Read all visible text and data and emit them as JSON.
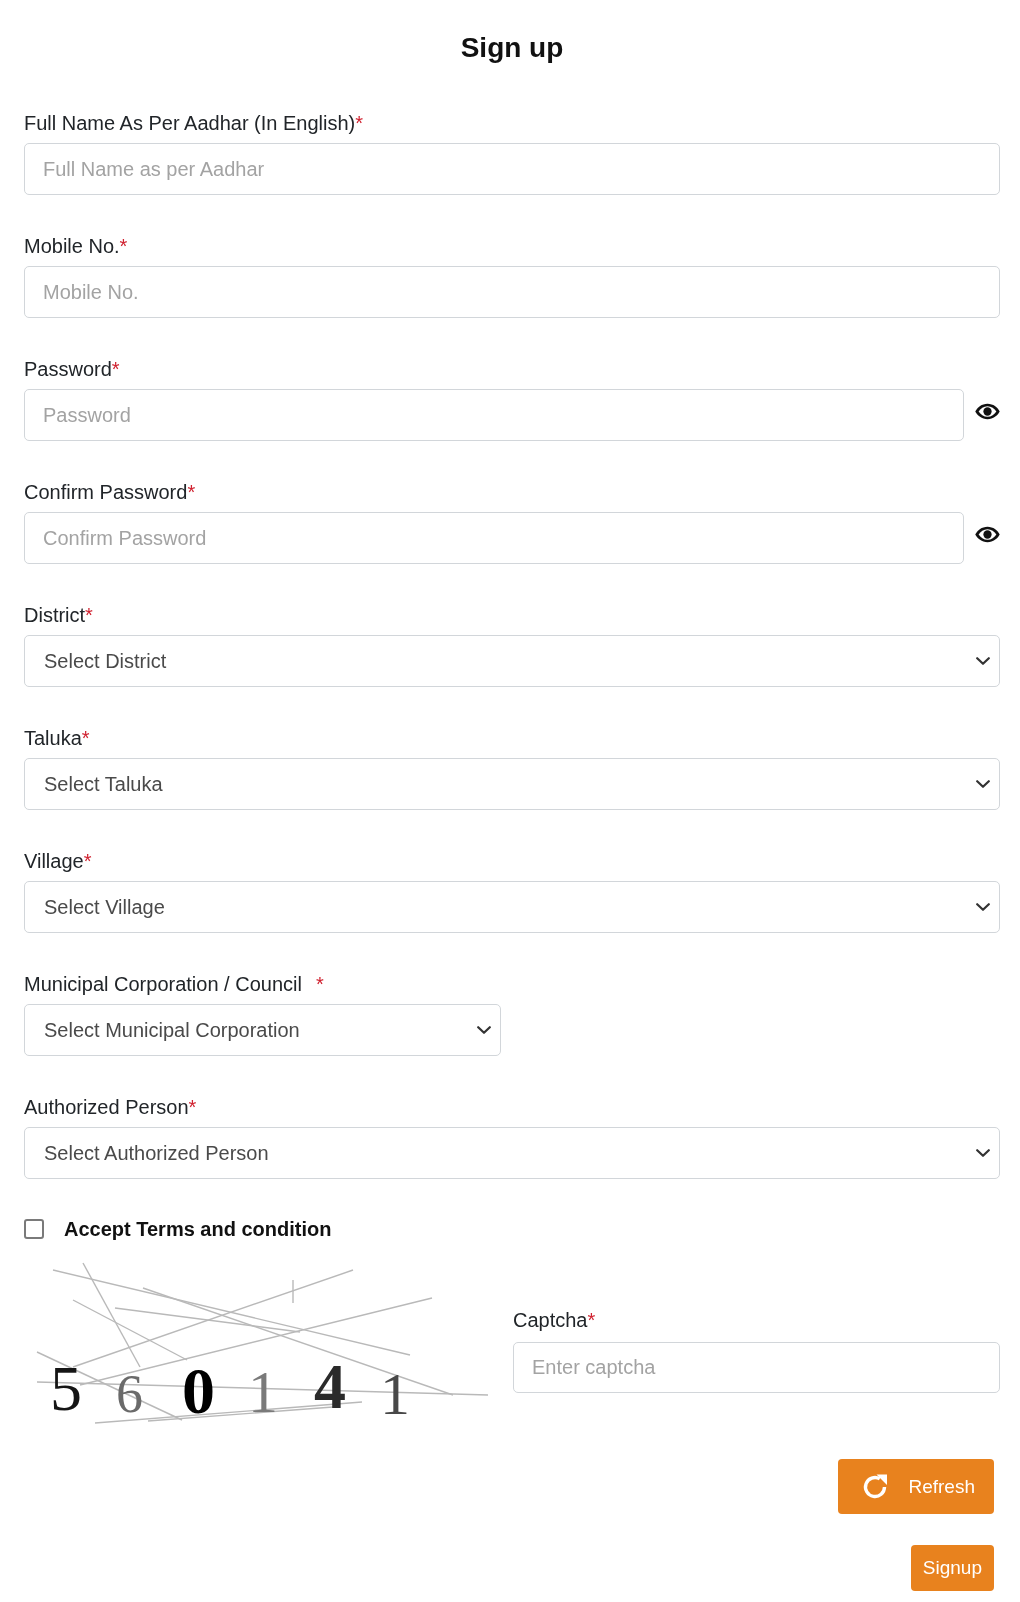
{
  "title": "Sign up",
  "fields": [
    {
      "kind": "text",
      "label": "Full Name As Per Aadhar (In English)",
      "required_mark": "*",
      "placeholder": "Full Name as per Aadhar"
    },
    {
      "kind": "text",
      "label": "Mobile No.",
      "required_mark": "*",
      "placeholder": "Mobile No."
    },
    {
      "kind": "password",
      "label": "Password",
      "required_mark": "*",
      "placeholder": "Password"
    },
    {
      "kind": "password",
      "label": "Confirm Password",
      "required_mark": "*",
      "placeholder": "Confirm Password"
    },
    {
      "kind": "select",
      "label": "District",
      "required_mark": "*",
      "value": "Select District"
    },
    {
      "kind": "select",
      "label": "Taluka",
      "required_mark": "*",
      "value": "Select Taluka"
    },
    {
      "kind": "select",
      "label": "Village",
      "required_mark": "*",
      "value": "Select Village"
    },
    {
      "kind": "short-select",
      "label": "Municipal Corporation / Council",
      "required_mark": "*",
      "value": "Select Municipal Corporation"
    },
    {
      "kind": "select",
      "label": "Authorized Person",
      "required_mark": "*",
      "value": "Select Authorized Person"
    }
  ],
  "terms": {
    "label": "Accept Terms and condition",
    "checked": false
  },
  "captcha": {
    "characters": [
      "5",
      "6",
      "0",
      "1",
      "4",
      "1"
    ],
    "label": "Captcha",
    "required_mark": "*",
    "placeholder": "Enter captcha"
  },
  "buttons": [
    {
      "kind": "refresh",
      "label": "Refresh"
    },
    {
      "kind": "submit",
      "label": "Signup"
    }
  ]
}
